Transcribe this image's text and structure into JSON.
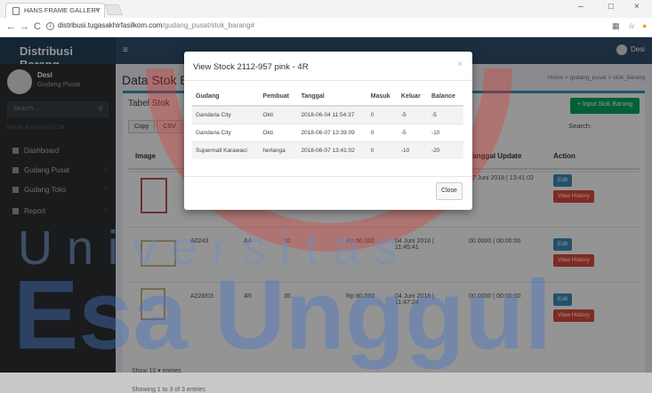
{
  "browser": {
    "tab_title": "HANS FRAME GALLERY",
    "tab_close": "×",
    "url_host": "distribusi.tugasakhirfasilkom.com",
    "url_path": "/gudang_pusat/stok_barang#",
    "window_controls": [
      "–",
      "□",
      "×"
    ]
  },
  "header": {
    "brand": "Distribusi Barang",
    "menu_icon": "≡",
    "user": "Desi"
  },
  "sidebar": {
    "user_name": "Desi",
    "user_role": "Gudang Pusat",
    "search_placeholder": "Search...",
    "section_header": "MAIN NAVIGATION",
    "items": [
      {
        "label": "Dashboard"
      },
      {
        "label": "Gudang Pusat"
      },
      {
        "label": "Gudang Toko"
      },
      {
        "label": "Report"
      }
    ]
  },
  "main": {
    "page_title": "Data Stok Ba",
    "breadcrumb": "Home  >  gudang_pusat  >  stok_barang",
    "box_title": "Tabel Stok",
    "input_button": "+ Input Stok Barang",
    "buttons": [
      "Copy",
      "CSV"
    ],
    "search_label": "Search:",
    "columns": {
      "image": "Image",
      "tanggal_update": "Tanggal Update",
      "action": "Action"
    },
    "rows": [
      {
        "kode": "",
        "ukuran": "",
        "stok": "",
        "harga": "",
        "tanggal_input": "",
        "tanggal_update": "07 Juni 2018 | 13:41:02"
      },
      {
        "kode": "A0243",
        "ukuran": "A4",
        "stok": "30",
        "harga": "Rp 50.000",
        "tanggal_input": "04 Juni 2018 | 11:45:41",
        "tanggal_update": "00 0000 | 00:00:00"
      },
      {
        "kode": "A228/03",
        "ukuran": "4R",
        "stok": "35",
        "harga": "Rp 80.000",
        "tanggal_input": "04 Juni 2018 | 11:47:24",
        "tanggal_update": "00 0000 | 00:00:00"
      }
    ],
    "edit_label": "Edit",
    "history_label": "View History",
    "show_entries": "Show  10  ▾  entries",
    "showing": "Showing 1 to 3 of 3 entries"
  },
  "modal": {
    "title": "View Stock 2112-957 pink - 4R",
    "close_x": "×",
    "headers": [
      "Gudang",
      "Pembuat",
      "Tanggal",
      "Masuk",
      "Keluar",
      "Balance"
    ],
    "rows": [
      [
        "Gandaria City",
        "Okti",
        "2018-06-04 11:54:37",
        "0",
        "-5",
        "-5"
      ],
      [
        "Gandaria City",
        "Okti",
        "2018-06-07 13:39:09",
        "0",
        "-5",
        "-10"
      ],
      [
        "Supermall Karawaci",
        "herlanga",
        "2018-06-07 13:41:02",
        "0",
        "-10",
        "-20"
      ]
    ],
    "close_button": "Close"
  },
  "watermark": {
    "line1": "Universitas",
    "line2": "Esa Unggul"
  }
}
